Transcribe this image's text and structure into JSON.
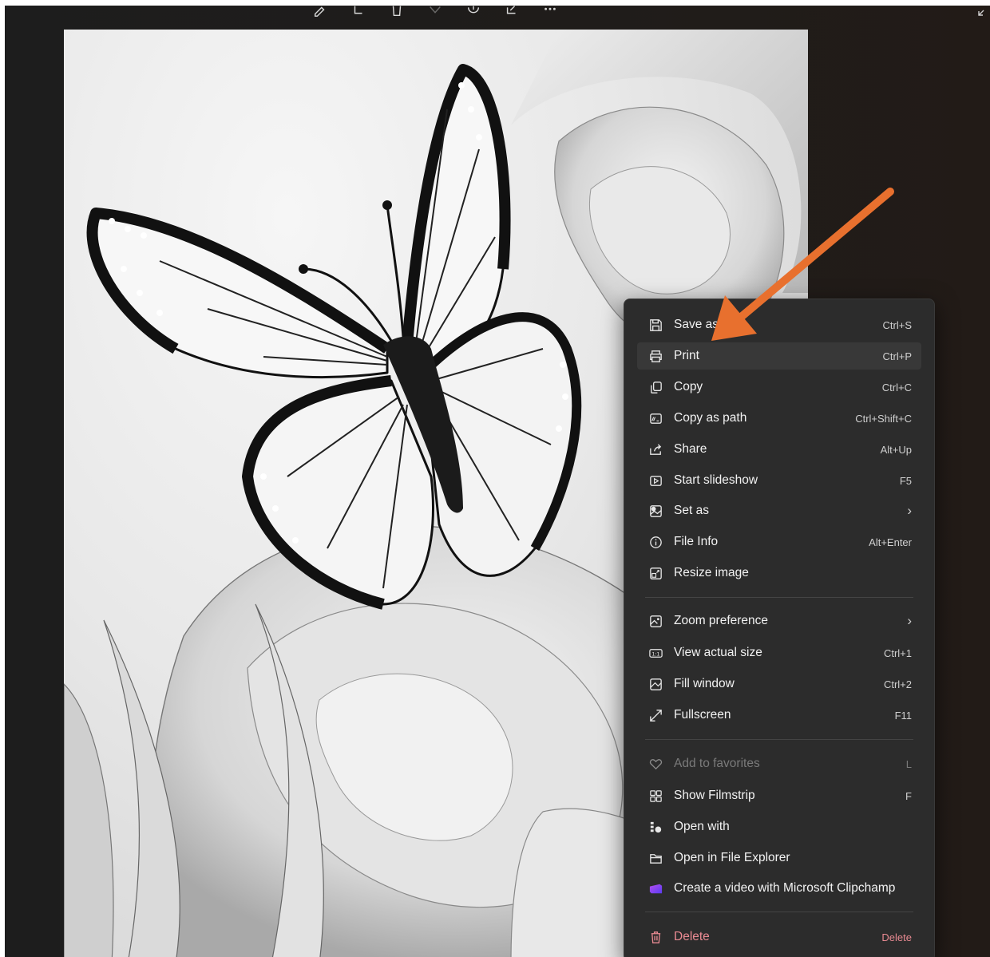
{
  "menu": {
    "items": [
      {
        "label": "Save as",
        "shortcut": "Ctrl+S",
        "icon": "save-as-icon"
      },
      {
        "label": "Print",
        "shortcut": "Ctrl+P",
        "icon": "print-icon"
      },
      {
        "label": "Copy",
        "shortcut": "Ctrl+C",
        "icon": "copy-icon"
      },
      {
        "label": "Copy as path",
        "shortcut": "Ctrl+Shift+C",
        "icon": "copy-path-icon"
      },
      {
        "label": "Share",
        "shortcut": "Alt+Up",
        "icon": "share-icon"
      },
      {
        "label": "Start slideshow",
        "shortcut": "F5",
        "icon": "slideshow-icon"
      },
      {
        "label": "Set as",
        "shortcut": "›",
        "icon": "set-as-icon"
      },
      {
        "label": "File Info",
        "shortcut": "Alt+Enter",
        "icon": "info-icon"
      },
      {
        "label": "Resize image",
        "shortcut": "",
        "icon": "resize-icon"
      },
      {
        "label": "Zoom preference",
        "shortcut": "›",
        "icon": "zoom-icon"
      },
      {
        "label": "View actual size",
        "shortcut": "Ctrl+1",
        "icon": "actual-size-icon"
      },
      {
        "label": "Fill window",
        "shortcut": "Ctrl+2",
        "icon": "fill-window-icon"
      },
      {
        "label": "Fullscreen",
        "shortcut": "F11",
        "icon": "fullscreen-icon"
      },
      {
        "label": "Add to favorites",
        "shortcut": "L",
        "icon": "heart-icon"
      },
      {
        "label": "Show Filmstrip",
        "shortcut": "F",
        "icon": "filmstrip-icon"
      },
      {
        "label": "Open with",
        "shortcut": "",
        "icon": "open-with-icon"
      },
      {
        "label": "Open in File Explorer",
        "shortcut": "",
        "icon": "folder-icon"
      },
      {
        "label": "Create a video with Microsoft Clipchamp",
        "shortcut": "",
        "icon": "clipchamp-icon"
      },
      {
        "label": "Delete",
        "shortcut": "Delete",
        "icon": "delete-icon"
      }
    ]
  },
  "colors": {
    "arrow": "#e8702e",
    "danger": "#e98a92",
    "menu_bg": "#2c2c2c"
  }
}
